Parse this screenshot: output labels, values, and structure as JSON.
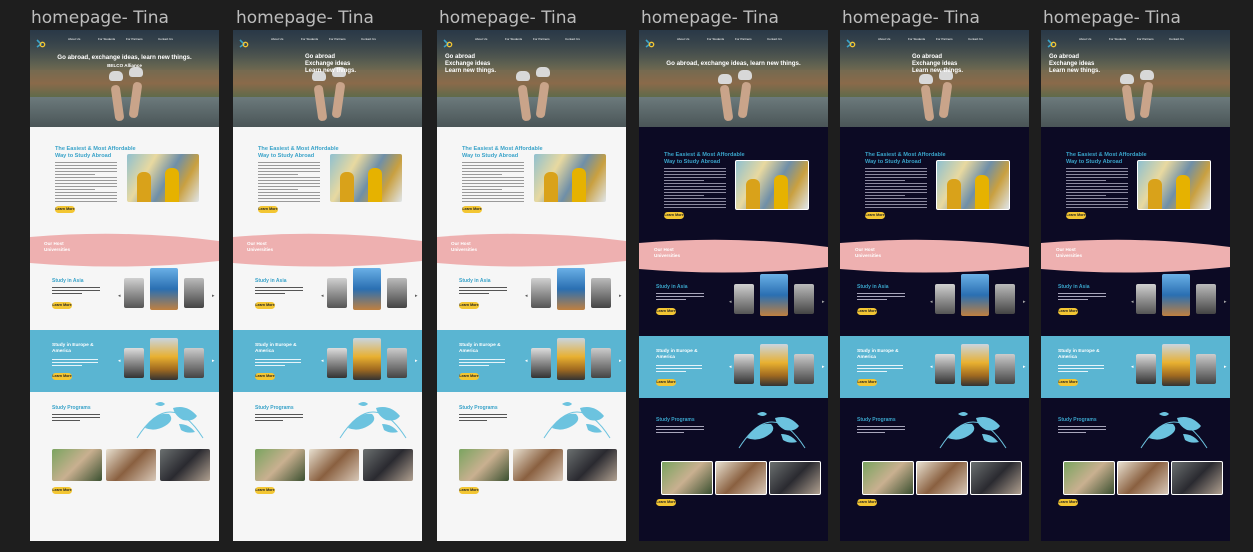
{
  "frames": [
    {
      "label": "homepage- Tina",
      "theme": "light",
      "hero_lines": [
        "Go abroad, exchange ideas, learn new things.",
        "BELCO Alliance"
      ]
    },
    {
      "label": "homepage- Tina",
      "theme": "light",
      "hero_lines": [
        "Go abroad",
        "Exchange ideas",
        "Learn new things."
      ]
    },
    {
      "label": "homepage- Tina",
      "theme": "light",
      "hero_lines": [
        "Go abroad",
        "Exchange ideas",
        "Learn new things."
      ]
    },
    {
      "label": "homepage- Tina",
      "theme": "dark",
      "hero_lines": [
        "Go abroad, exchange ideas, learn new things."
      ]
    },
    {
      "label": "homepage- Tina",
      "theme": "dark",
      "hero_lines": [
        "Go abroad",
        "Exchange ideas",
        "Learn new things."
      ]
    },
    {
      "label": "homepage- Tina",
      "theme": "dark",
      "hero_lines": [
        "Go abroad",
        "Exchange ideas",
        "Learn new things."
      ]
    }
  ],
  "nav": [
    "About Us",
    "For Students",
    "For Partners",
    "Contact Us"
  ],
  "sections": {
    "intro_title": [
      "The Easiest & Most Affordable",
      "Way to Study Abroad"
    ],
    "universities_title": [
      "Our Host",
      "Universities"
    ],
    "asia_title": "Study in Asia",
    "europe_title": [
      "Study in Europe &",
      "America"
    ],
    "programs_title": "Study Programs",
    "button_label": "Learn More"
  },
  "colors": {
    "accent_blue": "#3aa3c9",
    "band_blue": "#5ab5d2",
    "pink": "#eeb0b0",
    "button": "#f3c633",
    "dark_bg": "#0c0a24",
    "light_bg": "#f6f6f6"
  }
}
